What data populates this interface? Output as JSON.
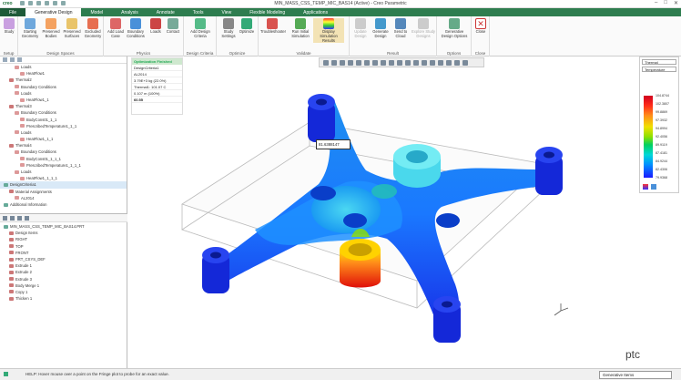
{
  "app": {
    "logo": "creo",
    "title": "MIN_MASS_CSS_TEMP_MIC_BAS14 (Active) - Creo Parametric"
  },
  "tabs": [
    "File",
    "Generative Design",
    "Model",
    "Analysis",
    "Annotate",
    "Tools",
    "View",
    "Flexible Modeling",
    "Applications"
  ],
  "ribbon": {
    "setup": {
      "name": "Setup",
      "buttons": [
        "Study"
      ]
    },
    "design_spaces": {
      "name": "Design Spaces",
      "buttons": [
        "Starting Geometry",
        "Preserved Bodies",
        "Preserved Surfaces",
        "Excluded Geometry"
      ]
    },
    "physics": {
      "name": "Physics",
      "buttons": [
        "Add Load Case",
        "Boundary Conditions",
        "Loads",
        "Contact"
      ]
    },
    "design_criteria": {
      "name": "Design Criteria",
      "buttons": [
        "Add Design Criteria"
      ]
    },
    "optimize": {
      "name": "Optimize",
      "buttons": [
        "Study Settings",
        "Optimize"
      ]
    },
    "validate": {
      "name": "Validate",
      "buttons": [
        "Troubleshooter",
        "Run Initial Simulation",
        "Display Simulation Results"
      ]
    },
    "result": {
      "name": "Result",
      "buttons": [
        "Update Design",
        "Generate Design",
        "Send to Cloud",
        "Explore Study Designs"
      ]
    },
    "options": {
      "name": "Options",
      "buttons": [
        "Generative Design Options"
      ]
    },
    "close": {
      "name": "Close",
      "buttons": [
        "Close"
      ]
    }
  },
  "study_tree": [
    {
      "label": "Loads",
      "level": 2
    },
    {
      "label": "HeatFlow1",
      "level": 3
    },
    {
      "label": "Thermal2",
      "level": 1
    },
    {
      "label": "Boundary Conditions",
      "level": 2
    },
    {
      "label": "Loads",
      "level": 2
    },
    {
      "label": "HeatFlow1_1",
      "level": 3
    },
    {
      "label": "Thermal3",
      "level": 1
    },
    {
      "label": "Boundary Conditions",
      "level": 2
    },
    {
      "label": "BodyCons01_1_1",
      "level": 3
    },
    {
      "label": "PrescribedTemperature1_1_1",
      "level": 3
    },
    {
      "label": "Loads",
      "level": 2
    },
    {
      "label": "HeatFlow1_1_1",
      "level": 3
    },
    {
      "label": "Thermal4",
      "level": 1
    },
    {
      "label": "Boundary Conditions",
      "level": 2
    },
    {
      "label": "BodyCons01_1_1_1",
      "level": 3
    },
    {
      "label": "PrescribedTemperature1_1_1_1",
      "level": 3
    },
    {
      "label": "Loads",
      "level": 2
    },
    {
      "label": "HeatFlow1_1_1_1",
      "level": 3
    },
    {
      "label": "DesignCriteria1",
      "level": 0,
      "selected": true
    },
    {
      "label": "Material Assignments",
      "level": 1
    },
    {
      "label": "AL2014",
      "level": 2
    },
    {
      "label": "Additional Information",
      "level": 0
    }
  ],
  "model_tree": [
    {
      "label": "MIN_MASS_CSS_TEMP_MIC_BAS14.PRT",
      "level": 0
    },
    {
      "label": "Design Items",
      "level": 1
    },
    {
      "label": "RIGHT",
      "level": 1
    },
    {
      "label": "TOP",
      "level": 1
    },
    {
      "label": "FRONT",
      "level": 1
    },
    {
      "label": "PRT_CSYS_DEF",
      "level": 1
    },
    {
      "label": "Extrude 1",
      "level": 1
    },
    {
      "label": "Extrude 2",
      "level": 1
    },
    {
      "label": "Extrude 3",
      "level": 1
    },
    {
      "label": "Body Merge 1",
      "level": 1
    },
    {
      "label": "Copy 1",
      "level": 1
    },
    {
      "label": "Thicken 1",
      "level": 1
    }
  ],
  "optimization_panel": {
    "header": "Optimization Finished",
    "rows": [
      "DesignCriteria1",
      "AL2014",
      "3.79E+3 kg (22.0%)",
      "Thermal1: 101.07 C",
      "0.107 m (100%)",
      "60.55"
    ]
  },
  "legend": {
    "quantity": "Thermal",
    "type": "Temperature",
    "values": [
      "104.8744",
      "102.3807",
      "99.8869",
      "97.3932",
      "94.8994",
      "92.4056",
      "89.9119",
      "87.4181",
      "84.9244",
      "82.4306",
      "79.9368"
    ],
    "colors": {
      "max": "#d0001f",
      "min": "#1a1aff"
    }
  },
  "probe_tag": "81.6388147",
  "status_bar": {
    "message": "HELP: Hover mouse over a point on the Fringe plot to probe for an exact value.",
    "filter": "Generative Items"
  },
  "watermark": "ptc"
}
